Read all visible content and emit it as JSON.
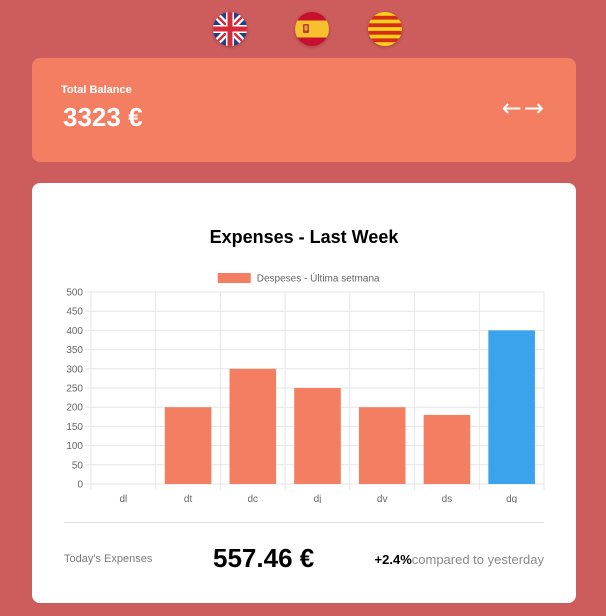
{
  "languages": [
    {
      "name": "English",
      "icon": "uk-flag-icon"
    },
    {
      "name": "Español",
      "icon": "spain-flag-icon"
    },
    {
      "name": "Català",
      "icon": "catalonia-flag-icon"
    }
  ],
  "balance": {
    "label": "Total Balance",
    "value": "3323 €",
    "prev_icon": "←",
    "next_icon": "→"
  },
  "expenses": {
    "title": "Expenses - Last Week",
    "today_label": "Today's Expenses",
    "today_value": "557.46 €",
    "change": "+2.4%",
    "change_text": "compared to yesterday"
  },
  "colors": {
    "background": "#cd5c5c",
    "balance_card": "#f47e62",
    "bar": "#f47e62",
    "bar_today": "#3ba3ec"
  },
  "chart_data": {
    "type": "bar",
    "title": "",
    "categories": [
      "dl",
      "dt",
      "dc",
      "dj",
      "dv",
      "ds",
      "dg"
    ],
    "series": [
      {
        "name": "Despeses - Última setmana",
        "values": [
          0,
          200,
          300,
          250,
          200,
          180,
          400
        ]
      }
    ],
    "highlight_index": 6,
    "ylim": [
      0,
      500
    ],
    "yticks": [
      "0",
      "50",
      "100",
      "150",
      "200",
      "250",
      "300",
      "350",
      "400",
      "450",
      "500"
    ],
    "grid": true,
    "legend": "top"
  }
}
